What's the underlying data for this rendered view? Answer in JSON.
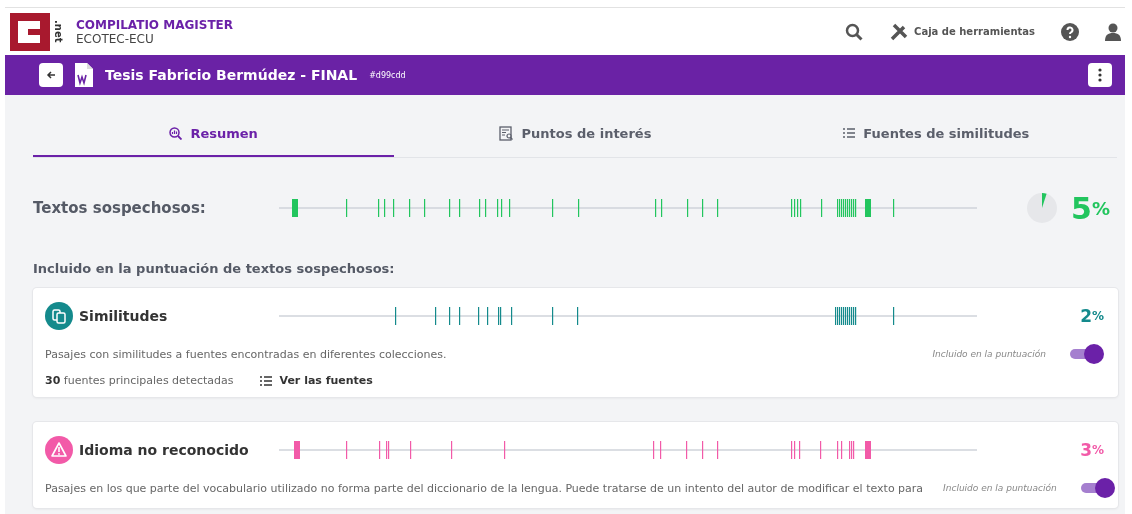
{
  "header": {
    "logo_text": ".net",
    "product": "COMPILATIO MAGISTER",
    "organization": "ECOTEC-ECU",
    "toolbox": "Caja de herramientas"
  },
  "document": {
    "title": "Tesis Fabricio Bermúdez - FINAL",
    "id": "#d99cdd"
  },
  "tabs": [
    {
      "label": "Resumen",
      "selected": true
    },
    {
      "label": "Puntos de interés",
      "selected": false
    },
    {
      "label": "Fuentes de similitudes",
      "selected": false
    }
  ],
  "summary": {
    "label": "Textos sospechosos:",
    "percent": "5",
    "unit": "%"
  },
  "section_title": "Incluido en la puntuación de textos sospechosos:",
  "cards": [
    {
      "kind": "similarity",
      "title": "Similitudes",
      "color": "#148a8c",
      "percent": "2",
      "unit": "%",
      "description": "Pasajes con similitudes a fuentes encontradas en diferentes colecciones.",
      "toggle_label": "Incluido en la puntuación",
      "on": true,
      "sources_count": "30",
      "sources_text": "fuentes principales detectadas",
      "sources_link": "Ver las fuentes"
    },
    {
      "kind": "language",
      "title": "Idioma no reconocido",
      "color": "#f25aa8",
      "percent": "3",
      "unit": "%",
      "description": "Pasajes en los que parte del vocabulario utilizado no forma parte del diccionario de la lengua. Puede tratarse de un intento del autor de modificar el texto para",
      "toggle_label": "Incluido en la puntuación",
      "on": true
    }
  ]
}
